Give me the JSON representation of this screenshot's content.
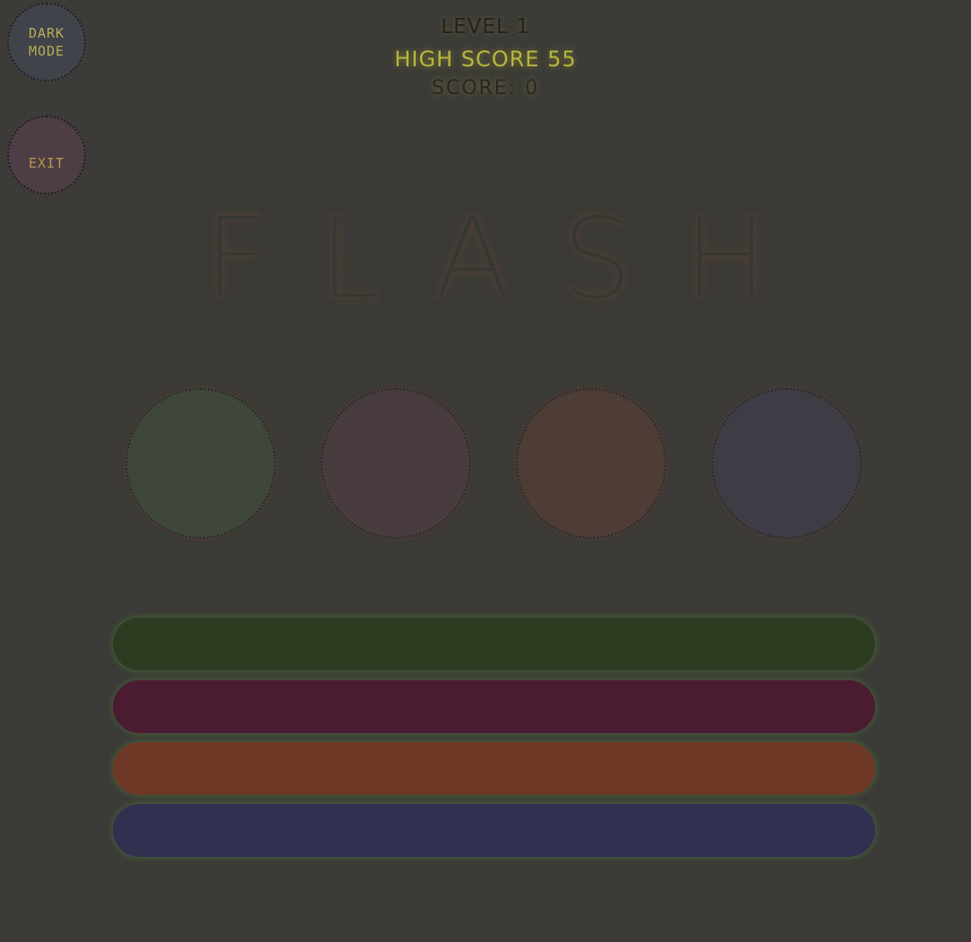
{
  "controls": {
    "dark_mode_label": "DARK\nMODE",
    "exit_label": "EXIT"
  },
  "header": {
    "level": "LEVEL 1",
    "high_score": "HIGH SCORE 55",
    "score": "SCORE: 0"
  },
  "title": "FLASH",
  "colors": {
    "background": "#3c3b37",
    "high_score": "#b8b53c",
    "circle_green": "#3f463a",
    "circle_maroon": "#483c3f",
    "circle_orange": "#4e3c37",
    "circle_blue": "#3e3d46",
    "bar_green": "#2d3c20",
    "bar_maroon": "#4b1c31",
    "bar_orange": "#6d3826",
    "bar_blue": "#323051"
  }
}
